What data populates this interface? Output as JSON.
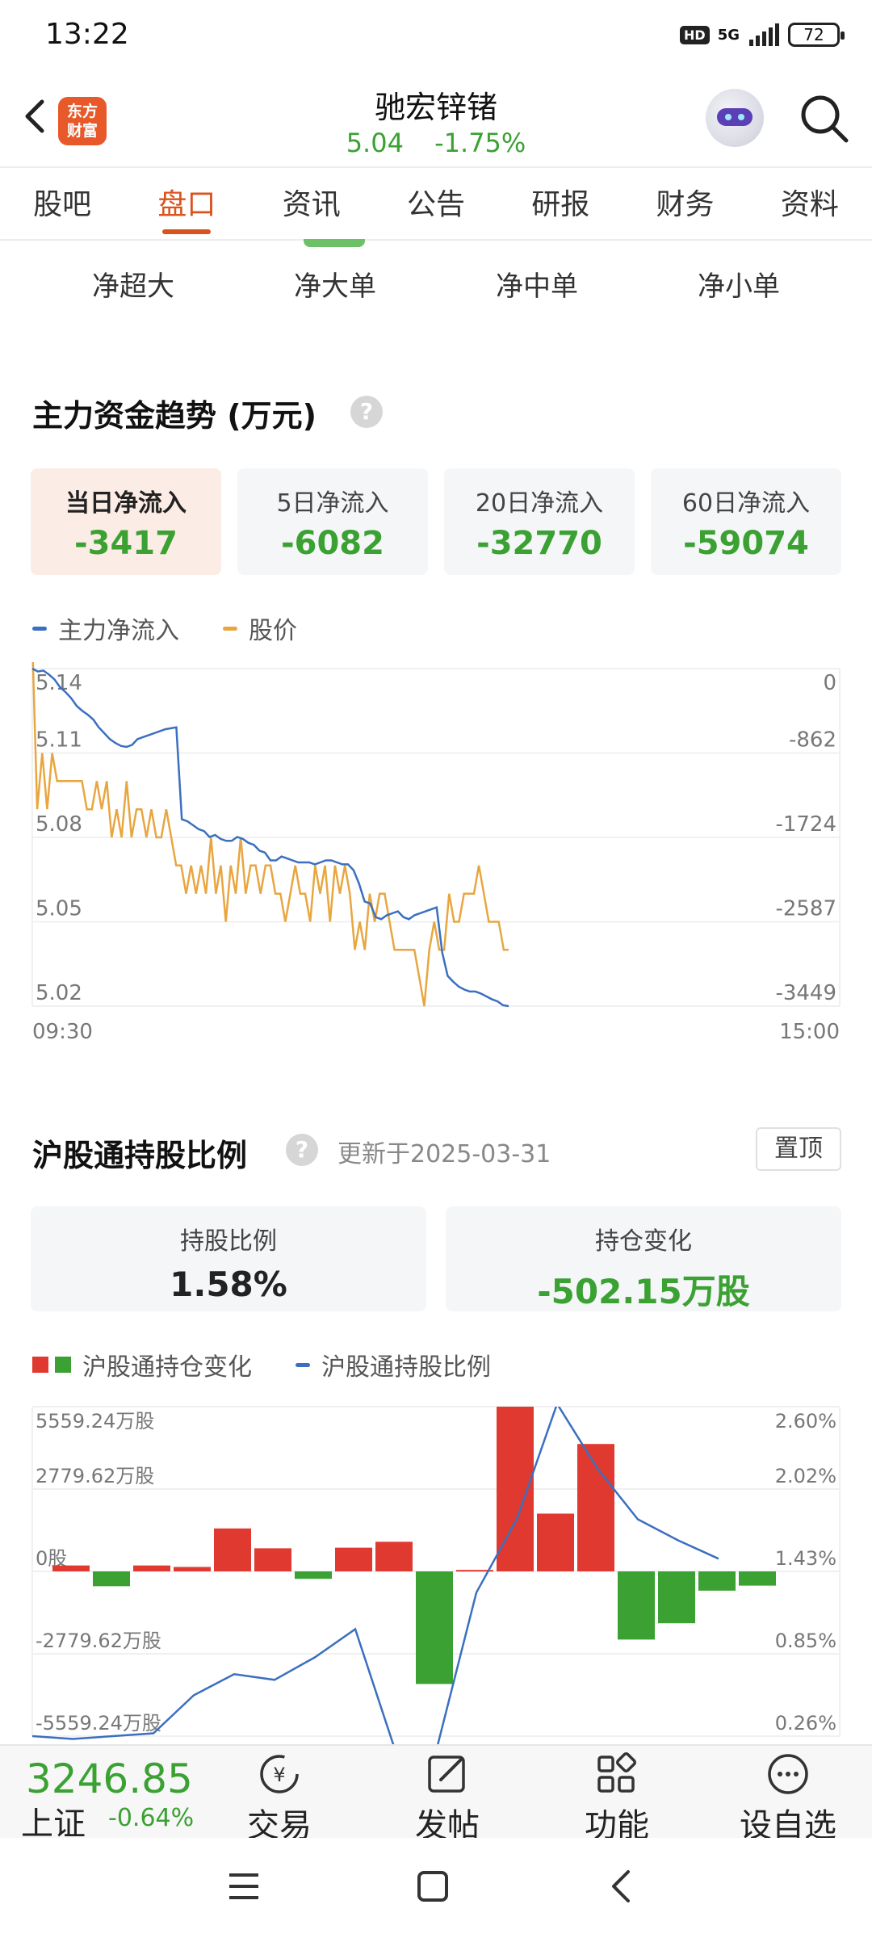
{
  "status_bar": {
    "time": "13:22",
    "hd": "HD",
    "network": "5G",
    "battery": "72"
  },
  "header": {
    "logo_line1": "东方",
    "logo_line2": "财富",
    "stock_name": "驰宏锌锗",
    "price": "5.04",
    "change_pct": "-1.75%"
  },
  "tabs": [
    "股吧",
    "盘口",
    "资讯",
    "公告",
    "研报",
    "财务",
    "资料"
  ],
  "active_tab": 1,
  "sub_tabs": [
    "净超大",
    "净大单",
    "净中单",
    "净小单"
  ],
  "capital_trend": {
    "title": "主力资金趋势 (万元)",
    "help": "?",
    "cards": [
      {
        "label": "当日净流入",
        "value": "-3417"
      },
      {
        "label": "5日净流入",
        "value": "-6082"
      },
      {
        "label": "20日净流入",
        "value": "-32770"
      },
      {
        "label": "60日净流入",
        "value": "-59074"
      }
    ],
    "legend_flow": "主力净流入",
    "legend_price": "股价"
  },
  "holding": {
    "title": "沪股通持股比例",
    "help": "?",
    "updated": "更新于2025-03-31",
    "pin_label": "置顶",
    "ratio_label": "持股比例",
    "ratio_value": "1.58%",
    "change_label": "持仓变化",
    "change_value": "-502.15万股",
    "legend_bars": "沪股通持仓变化",
    "legend_line": "沪股通持股比例"
  },
  "bottom_bar": {
    "index_value": "3246.85",
    "index_name": "上证",
    "index_change": "-0.64%",
    "nav": [
      "交易",
      "发帖",
      "功能",
      "设自选"
    ]
  },
  "colors": {
    "accent": "#d9531e",
    "down_green": "#3aa132",
    "up_red": "#e03a30",
    "flow_line": "#3b6fbf",
    "price_line": "#e8a640"
  },
  "chart_data": [
    {
      "type": "line",
      "title": "",
      "x_start_label": "09:30",
      "x_end_label": "15:00",
      "left_axis": {
        "ticks": [
          "5.14",
          "5.11",
          "5.08",
          "5.05",
          "5.02"
        ],
        "range": [
          5.02,
          5.14
        ]
      },
      "right_axis": {
        "ticks": [
          "0",
          "-862",
          "-1724",
          "-2587",
          "-3449"
        ],
        "range": [
          -3449,
          0
        ]
      },
      "series": [
        {
          "name": "主力净流入",
          "axis": "right",
          "values": [
            0,
            -30,
            -20,
            -60,
            -110,
            -190,
            -240,
            -300,
            -380,
            -430,
            -470,
            -520,
            -600,
            -660,
            -720,
            -760,
            -790,
            -800,
            -780,
            -720,
            -700,
            -680,
            -660,
            -640,
            -620,
            -610,
            -600,
            -1540,
            -1560,
            -1600,
            -1640,
            -1660,
            -1720,
            -1700,
            -1740,
            -1760,
            -1760,
            -1720,
            -1740,
            -1780,
            -1800,
            -1860,
            -1880,
            -1960,
            -1960,
            -1920,
            -1940,
            -1960,
            -1980,
            -1980,
            -1980,
            -2000,
            -1980,
            -1960,
            -1960,
            -1980,
            -2000,
            -2000,
            -2060,
            -2200,
            -2380,
            -2400,
            -2540,
            -2560,
            -2520,
            -2500,
            -2480,
            -2540,
            -2560,
            -2520,
            -2500,
            -2480,
            -2460,
            -2440,
            -2900,
            -3140,
            -3200,
            -3250,
            -3280,
            -3300,
            -3300,
            -3320,
            -3350,
            -3380,
            -3400,
            -3440,
            -3449
          ]
        },
        {
          "name": "股价",
          "axis": "left",
          "values": [
            5.15,
            5.09,
            5.11,
            5.09,
            5.11,
            5.1,
            5.1,
            5.1,
            5.1,
            5.1,
            5.1,
            5.09,
            5.09,
            5.1,
            5.09,
            5.1,
            5.08,
            5.09,
            5.08,
            5.1,
            5.08,
            5.09,
            5.09,
            5.08,
            5.09,
            5.08,
            5.08,
            5.09,
            5.08,
            5.07,
            5.07,
            5.06,
            5.07,
            5.06,
            5.07,
            5.06,
            5.08,
            5.06,
            5.07,
            5.05,
            5.07,
            5.06,
            5.08,
            5.06,
            5.07,
            5.07,
            5.06,
            5.07,
            5.07,
            5.06,
            5.06,
            5.05,
            5.06,
            5.07,
            5.06,
            5.06,
            5.05,
            5.07,
            5.06,
            5.07,
            5.05,
            5.07,
            5.06,
            5.07,
            5.06,
            5.04,
            5.05,
            5.04,
            5.06,
            5.05,
            5.06,
            5.06,
            5.05,
            5.04,
            5.04,
            5.04,
            5.04,
            5.04,
            5.03,
            5.02,
            5.04,
            5.05,
            5.04,
            5.04,
            5.06,
            5.05,
            5.05,
            5.06,
            5.06,
            5.06,
            5.07,
            5.06,
            5.05,
            5.05,
            5.05,
            5.04,
            5.04
          ]
        }
      ]
    },
    {
      "type": "bar",
      "title": "",
      "left_axis": {
        "ticks": [
          "5559.24万股",
          "2779.62万股",
          "0股",
          "-2779.62万股",
          "-5559.24万股"
        ],
        "range": [
          -5559.24,
          5559.24
        ]
      },
      "right_axis": {
        "ticks": [
          "2.60%",
          "2.02%",
          "1.43%",
          "0.85%",
          "0.26%"
        ],
        "range": [
          0.26,
          2.6
        ]
      },
      "series": [
        {
          "name": "沪股通持仓变化",
          "axis": "left",
          "values": [
            200,
            -500,
            200,
            150,
            1450,
            780,
            -250,
            800,
            1000,
            -3800,
            50,
            5559,
            1950,
            4300,
            -2300,
            -1750,
            -650,
            -480
          ]
        },
        {
          "name": "沪股通持股比例",
          "axis": "left-pct",
          "values": [
            0.26,
            0.24,
            0.26,
            0.28,
            0.55,
            0.7,
            0.66,
            0.82,
            1.02,
            0.15,
            0.15,
            1.28,
            1.8,
            2.62,
            2.16,
            1.8,
            1.65,
            1.52
          ]
        }
      ]
    }
  ]
}
